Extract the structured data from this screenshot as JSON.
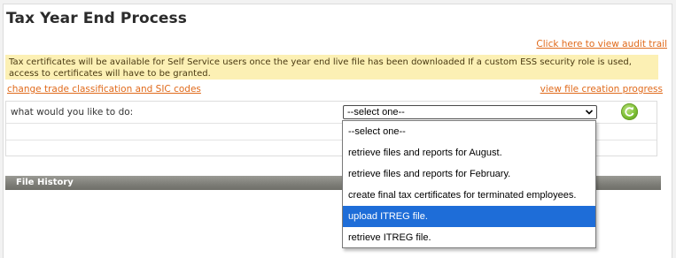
{
  "page": {
    "title": "Tax Year End Process",
    "audit_link": "Click here to view audit trail",
    "notice": "Tax certificates will be available for Self Service users once the year end live file has been downloaded If a custom ESS security role is used, access to certificates will have to be granted.",
    "trade_link": "change trade classification and SIC codes",
    "progress_link": "view file creation progress"
  },
  "form": {
    "question": "what would you like to do:",
    "selected_value": "--select one--",
    "refresh_icon": "refresh-icon"
  },
  "dropdown": {
    "options": [
      "--select one--",
      "retrieve files and reports for August.",
      "retrieve files and reports for February.",
      "create final tax certificates for terminated employees.",
      "upload ITREG file.",
      "retrieve ITREG file."
    ],
    "highlighted_option": "upload ITREG file."
  },
  "file_history": {
    "header": "File History"
  },
  "colors": {
    "link": "#e06a1b",
    "notice_bg": "#fcf0b4",
    "highlight": "#1e6dd8",
    "header_bar": "#7d7d77"
  }
}
